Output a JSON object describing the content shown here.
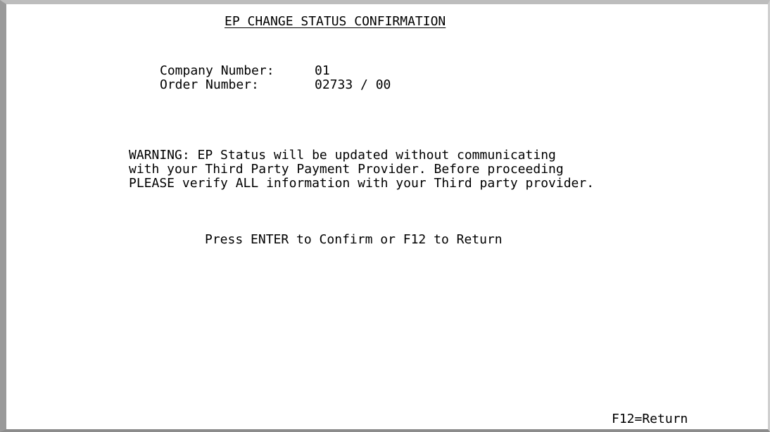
{
  "screen": {
    "title": "EP CHANGE STATUS CONFIRMATION"
  },
  "fields": {
    "company": {
      "label": "Company Number:",
      "value": "01"
    },
    "order": {
      "label": "Order Number:",
      "value": "02733 / 00"
    }
  },
  "warning": {
    "line1": "WARNING: EP Status will be updated without communicating",
    "line2": "with your Third Party Payment Provider. Before proceeding",
    "line3": "PLEASE verify ALL information with your Third party provider."
  },
  "prompt": "Press ENTER to Confirm or F12 to Return",
  "function_keys": {
    "f12": "F12=Return"
  }
}
